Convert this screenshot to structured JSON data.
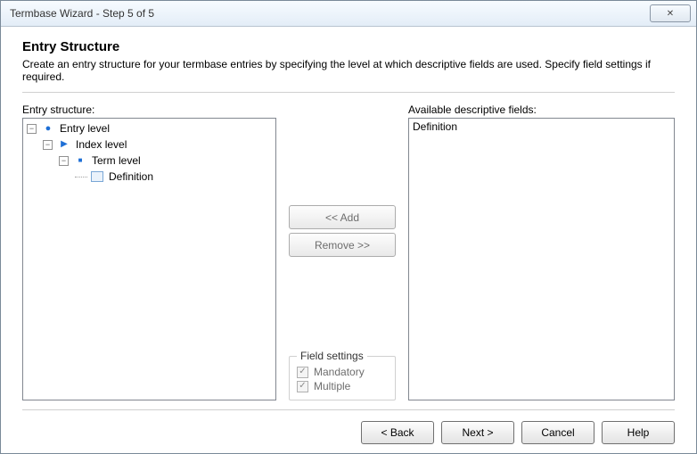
{
  "window": {
    "title": "Termbase Wizard - Step 5 of 5",
    "close_glyph": "✕"
  },
  "header": {
    "heading": "Entry Structure",
    "subtext": "Create an entry structure for your termbase entries by specifying the level at which descriptive fields are used. Specify field settings if required."
  },
  "left": {
    "label": "Entry structure:",
    "tree": {
      "entry": "Entry level",
      "index": "Index level",
      "term": "Term level",
      "definition": "Definition"
    }
  },
  "mid": {
    "add": "<< Add",
    "remove": "Remove >>",
    "fieldset_legend": "Field settings",
    "mandatory": "Mandatory",
    "multiple": "Multiple",
    "check_glyph": "✓"
  },
  "right": {
    "label": "Available descriptive fields:",
    "item": "Definition"
  },
  "footer": {
    "back": "< Back",
    "next": "Next >",
    "cancel": "Cancel",
    "help": "Help"
  }
}
